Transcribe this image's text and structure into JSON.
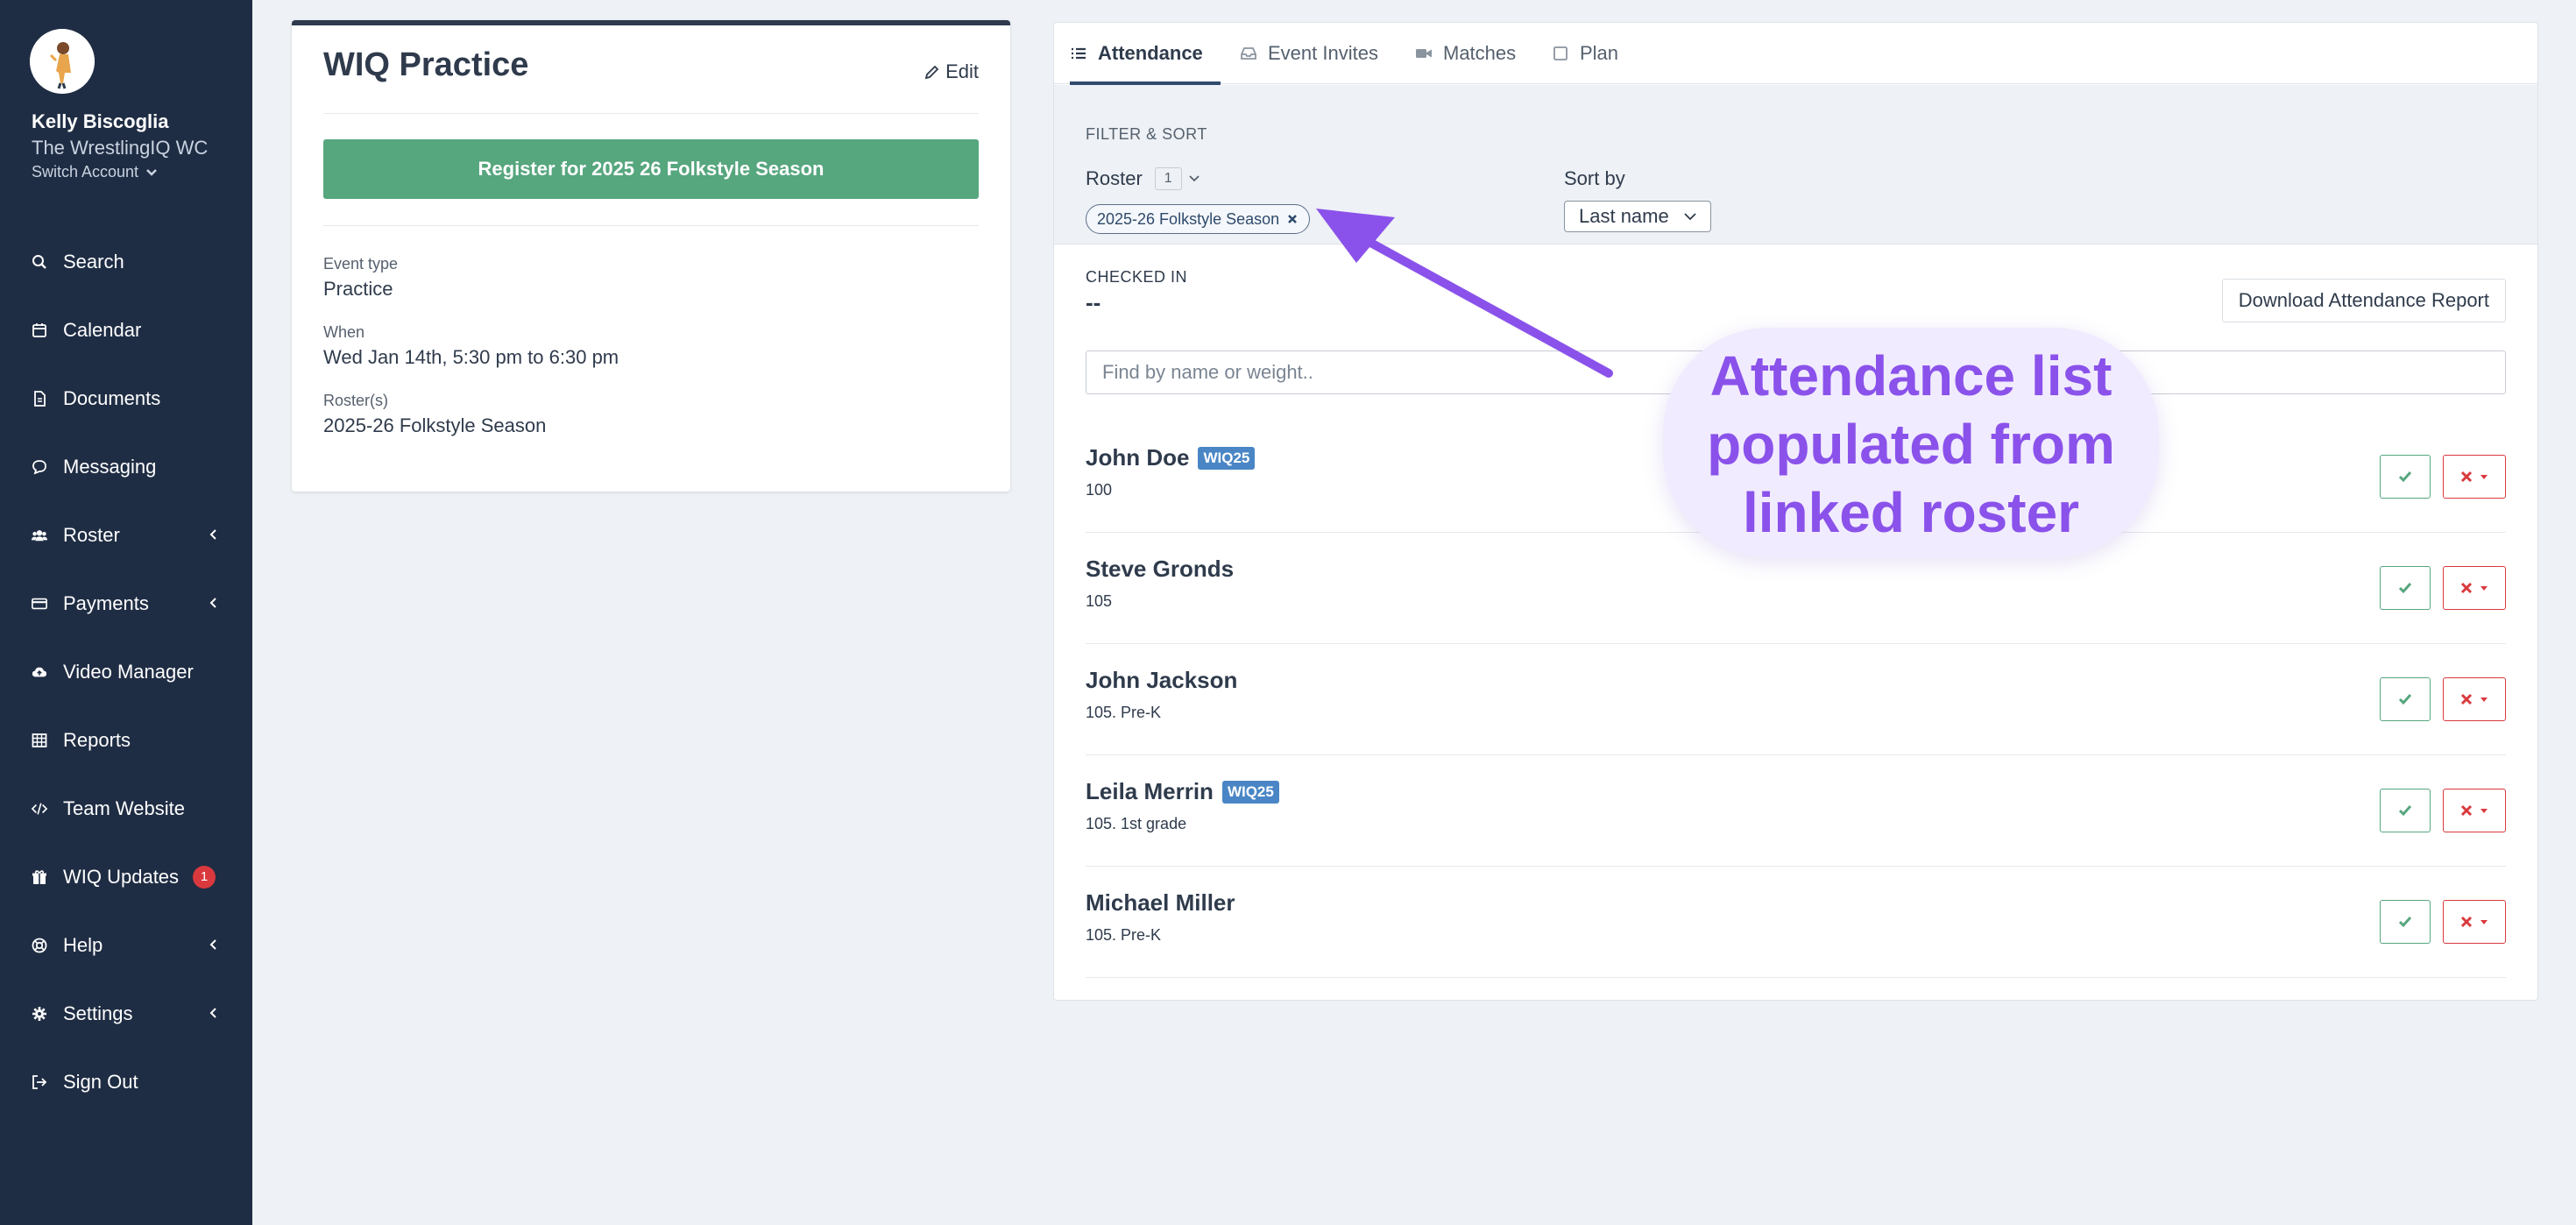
{
  "user": {
    "name": "Kelly Biscoglia",
    "team": "The WrestlingIQ WC",
    "switch_account": "Switch Account"
  },
  "nav": [
    {
      "label": "Search",
      "icon": "search-icon"
    },
    {
      "label": "Calendar",
      "icon": "calendar-icon"
    },
    {
      "label": "Documents",
      "icon": "document-icon"
    },
    {
      "label": "Messaging",
      "icon": "chat-icon"
    },
    {
      "label": "Roster",
      "icon": "users-icon"
    },
    {
      "label": "Payments",
      "icon": "credit-card-icon"
    },
    {
      "label": "Video Manager",
      "icon": "cloud-upload-icon"
    },
    {
      "label": "Reports",
      "icon": "table-icon"
    },
    {
      "label": "Team Website",
      "icon": "code-icon"
    },
    {
      "label": "WIQ Updates",
      "icon": "gift-icon",
      "badge": "1"
    },
    {
      "label": "Help",
      "icon": "lifebuoy-icon"
    },
    {
      "label": "Settings",
      "icon": "gear-icon"
    },
    {
      "label": "Sign Out",
      "icon": "sign-out-icon"
    }
  ],
  "event": {
    "title": "WIQ Practice",
    "edit_label": "Edit",
    "register_label": "Register for 2025 26 Folkstyle Season",
    "event_type_label": "Event type",
    "event_type_value": "Practice",
    "when_label": "When",
    "when_value": "Wed Jan 14th, 5:30 pm to 6:30 pm",
    "rosters_label": "Roster(s)",
    "rosters_value": "2025-26 Folkstyle Season"
  },
  "tabs": [
    {
      "label": "Attendance",
      "active": true
    },
    {
      "label": "Event Invites",
      "active": false
    },
    {
      "label": "Matches",
      "active": false
    },
    {
      "label": "Plan",
      "active": false
    }
  ],
  "filter": {
    "heading": "FILTER & SORT",
    "roster_label": "Roster",
    "roster_count": "1",
    "roster_tag": "2025-26 Folkstyle Season",
    "sort_label": "Sort by",
    "sort_value": "Last name"
  },
  "attendance": {
    "checked_in_label": "CHECKED IN",
    "checked_in_value": "--",
    "download_label": "Download Attendance Report",
    "search_placeholder": "Find by name or weight..",
    "rows": [
      {
        "name": "John Doe",
        "tag": "WIQ25",
        "sub": "100"
      },
      {
        "name": "Steve Gronds",
        "tag": "",
        "sub": "105"
      },
      {
        "name": "John Jackson",
        "tag": "",
        "sub": "105. Pre-K"
      },
      {
        "name": "Leila Merrin",
        "tag": "WIQ25",
        "sub": "105. 1st grade"
      },
      {
        "name": "Michael Miller",
        "tag": "",
        "sub": "105. Pre-K"
      }
    ]
  },
  "annotation": {
    "line1": "Attendance list",
    "line2": "populated from",
    "line3": "linked roster"
  },
  "colors": {
    "sidebar": "#1f2d44",
    "register": "#56a67e",
    "tag": "#4a86c5",
    "annotation": "#8a52ea",
    "danger": "#d9393d"
  }
}
